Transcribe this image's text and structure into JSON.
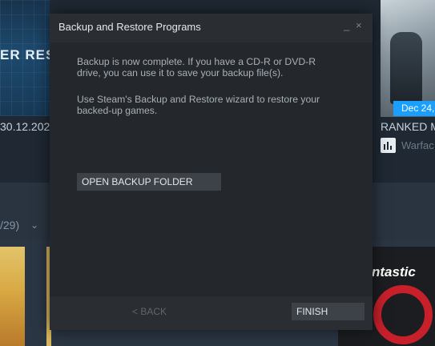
{
  "background": {
    "left_card": {
      "title_fragment": "ER REST",
      "date_fragment": "30.12.202"
    },
    "right_card": {
      "date_badge": "Dec 24,",
      "title_fragment": "RANKED M",
      "publisher_fragment": "Warfac"
    },
    "collection_count": "/29)",
    "collection_chevron": "⌄",
    "tile_text_fragment": "ntastic"
  },
  "dialog": {
    "title": "Backup and Restore Programs",
    "minimize_glyph": "_",
    "close_glyph": "×",
    "message_1": "Backup is now complete. If you have a CD-R or DVD-R drive, you can use it to save your backup file(s).",
    "message_2": "Use Steam's Backup and Restore wizard to restore your backed-up games.",
    "open_folder_button": "OPEN BACKUP FOLDER",
    "back_button": "< BACK",
    "finish_button": "FINISH"
  },
  "colors": {
    "dialog_bg": "#2a2e33",
    "dialog_body": "#24282d",
    "button_bg": "#3d4248",
    "badge_blue": "#1a9fff"
  }
}
